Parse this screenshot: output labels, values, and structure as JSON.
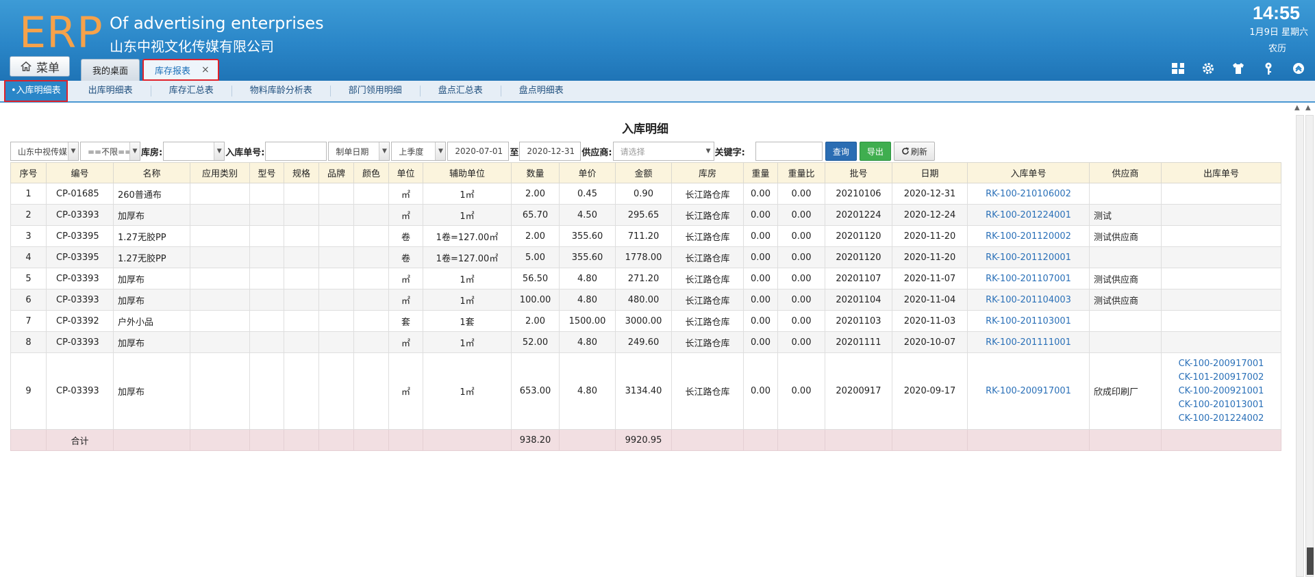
{
  "header": {
    "logo": "ERP",
    "company_en": "Of advertising enterprises",
    "company_cn": "山东中视文化传媒有限公司",
    "time": "14:55",
    "date": "1月9日 星期六",
    "lunar": "农历",
    "menu_label": "菜单",
    "tabs": [
      {
        "label": "我的桌面",
        "active": false
      },
      {
        "label": "库存报表",
        "active": true,
        "close": "×"
      }
    ],
    "toolbar_icons": [
      "layout-grid-icon",
      "gear-icon",
      "shirt-icon",
      "key-icon",
      "collapse-up-icon"
    ]
  },
  "subnav": {
    "items": [
      {
        "label": "•入库明细表",
        "active": true
      },
      {
        "label": "出库明细表"
      },
      {
        "label": "库存汇总表"
      },
      {
        "label": "物料库龄分析表"
      },
      {
        "label": "部门领用明细"
      },
      {
        "label": "盘点汇总表"
      },
      {
        "label": "盘点明细表"
      }
    ]
  },
  "page": {
    "title": "入库明细"
  },
  "filters": {
    "company": "山东中视传媒",
    "scope": "==不限==",
    "warehouse_label": "库房:",
    "warehouse_value": "",
    "order_label": "入库单号:",
    "order_value": "",
    "date_type": "制单日期",
    "period": "上季度",
    "date_from": "2020-07-01",
    "to_label": "至",
    "date_to": "2020-12-31",
    "supplier_label": "供应商:",
    "supplier_placeholder": "请选择",
    "keyword_label": "关键字:",
    "keyword_value": "",
    "query_btn": "查询",
    "export_btn": "导出",
    "refresh_btn": "刷新"
  },
  "table": {
    "headers": [
      "序号",
      "编号",
      "名称",
      "应用类别",
      "型号",
      "规格",
      "品牌",
      "颜色",
      "单位",
      "辅助单位",
      "数量",
      "单价",
      "金额",
      "库房",
      "重量",
      "重量比",
      "批号",
      "日期",
      "入库单号",
      "供应商",
      "出库单号"
    ],
    "rows": [
      {
        "no": "1",
        "code": "CP-01685",
        "name": "260普通布",
        "cat": "",
        "model": "",
        "spec": "",
        "brand": "",
        "color": "",
        "unit": "㎡",
        "aux": "1㎡",
        "qty": "2.00",
        "price": "0.45",
        "amount": "0.90",
        "wh": "长江路仓库",
        "weight": "0.00",
        "wratio": "0.00",
        "batch": "20210106",
        "date": "2020-12-31",
        "in_no": "RK-100-210106002",
        "supplier": "",
        "out_nos": []
      },
      {
        "no": "2",
        "code": "CP-03393",
        "name": "加厚布",
        "cat": "",
        "model": "",
        "spec": "",
        "brand": "",
        "color": "",
        "unit": "㎡",
        "aux": "1㎡",
        "qty": "65.70",
        "price": "4.50",
        "amount": "295.65",
        "wh": "长江路仓库",
        "weight": "0.00",
        "wratio": "0.00",
        "batch": "20201224",
        "date": "2020-12-24",
        "in_no": "RK-100-201224001",
        "supplier": "测试",
        "out_nos": []
      },
      {
        "no": "3",
        "code": "CP-03395",
        "name": "1.27无胶PP",
        "cat": "",
        "model": "",
        "spec": "",
        "brand": "",
        "color": "",
        "unit": "卷",
        "aux": "1卷=127.00㎡",
        "qty": "2.00",
        "price": "355.60",
        "amount": "711.20",
        "wh": "长江路仓库",
        "weight": "0.00",
        "wratio": "0.00",
        "batch": "20201120",
        "date": "2020-11-20",
        "in_no": "RK-100-201120002",
        "supplier": "测试供应商",
        "out_nos": []
      },
      {
        "no": "4",
        "code": "CP-03395",
        "name": "1.27无胶PP",
        "cat": "",
        "model": "",
        "spec": "",
        "brand": "",
        "color": "",
        "unit": "卷",
        "aux": "1卷=127.00㎡",
        "qty": "5.00",
        "price": "355.60",
        "amount": "1778.00",
        "wh": "长江路仓库",
        "weight": "0.00",
        "wratio": "0.00",
        "batch": "20201120",
        "date": "2020-11-20",
        "in_no": "RK-100-201120001",
        "supplier": "",
        "out_nos": []
      },
      {
        "no": "5",
        "code": "CP-03393",
        "name": "加厚布",
        "cat": "",
        "model": "",
        "spec": "",
        "brand": "",
        "color": "",
        "unit": "㎡",
        "aux": "1㎡",
        "qty": "56.50",
        "price": "4.80",
        "amount": "271.20",
        "wh": "长江路仓库",
        "weight": "0.00",
        "wratio": "0.00",
        "batch": "20201107",
        "date": "2020-11-07",
        "in_no": "RK-100-201107001",
        "supplier": "测试供应商",
        "out_nos": []
      },
      {
        "no": "6",
        "code": "CP-03393",
        "name": "加厚布",
        "cat": "",
        "model": "",
        "spec": "",
        "brand": "",
        "color": "",
        "unit": "㎡",
        "aux": "1㎡",
        "qty": "100.00",
        "price": "4.80",
        "amount": "480.00",
        "wh": "长江路仓库",
        "weight": "0.00",
        "wratio": "0.00",
        "batch": "20201104",
        "date": "2020-11-04",
        "in_no": "RK-100-201104003",
        "supplier": "测试供应商",
        "out_nos": []
      },
      {
        "no": "7",
        "code": "CP-03392",
        "name": "户外小品",
        "cat": "",
        "model": "",
        "spec": "",
        "brand": "",
        "color": "",
        "unit": "套",
        "aux": "1套",
        "qty": "2.00",
        "price": "1500.00",
        "amount": "3000.00",
        "wh": "长江路仓库",
        "weight": "0.00",
        "wratio": "0.00",
        "batch": "20201103",
        "date": "2020-11-03",
        "in_no": "RK-100-201103001",
        "supplier": "",
        "out_nos": []
      },
      {
        "no": "8",
        "code": "CP-03393",
        "name": "加厚布",
        "cat": "",
        "model": "",
        "spec": "",
        "brand": "",
        "color": "",
        "unit": "㎡",
        "aux": "1㎡",
        "qty": "52.00",
        "price": "4.80",
        "amount": "249.60",
        "wh": "长江路仓库",
        "weight": "0.00",
        "wratio": "0.00",
        "batch": "20201111",
        "date": "2020-10-07",
        "in_no": "RK-100-201111001",
        "supplier": "",
        "out_nos": []
      },
      {
        "no": "9",
        "code": "CP-03393",
        "name": "加厚布",
        "cat": "",
        "model": "",
        "spec": "",
        "brand": "",
        "color": "",
        "unit": "㎡",
        "aux": "1㎡",
        "qty": "653.00",
        "price": "4.80",
        "amount": "3134.40",
        "wh": "长江路仓库",
        "weight": "0.00",
        "wratio": "0.00",
        "batch": "20200917",
        "date": "2020-09-17",
        "in_no": "RK-100-200917001",
        "supplier": "欣成印刷厂",
        "out_nos": [
          "CK-100-200917001",
          "CK-101-200917002",
          "CK-100-200921001",
          "CK-100-201013001",
          "CK-100-201224002"
        ]
      }
    ],
    "total": {
      "label": "合计",
      "qty": "938.20",
      "amount": "9920.95"
    }
  },
  "colors": {
    "header_blue": "#2a86c8",
    "logo_orange": "#f6a24a",
    "link_blue": "#2a70b8",
    "header_row_bg": "#fbf4dd",
    "total_row_bg": "#f2dfe2",
    "highlight_red": "#e0212a"
  }
}
